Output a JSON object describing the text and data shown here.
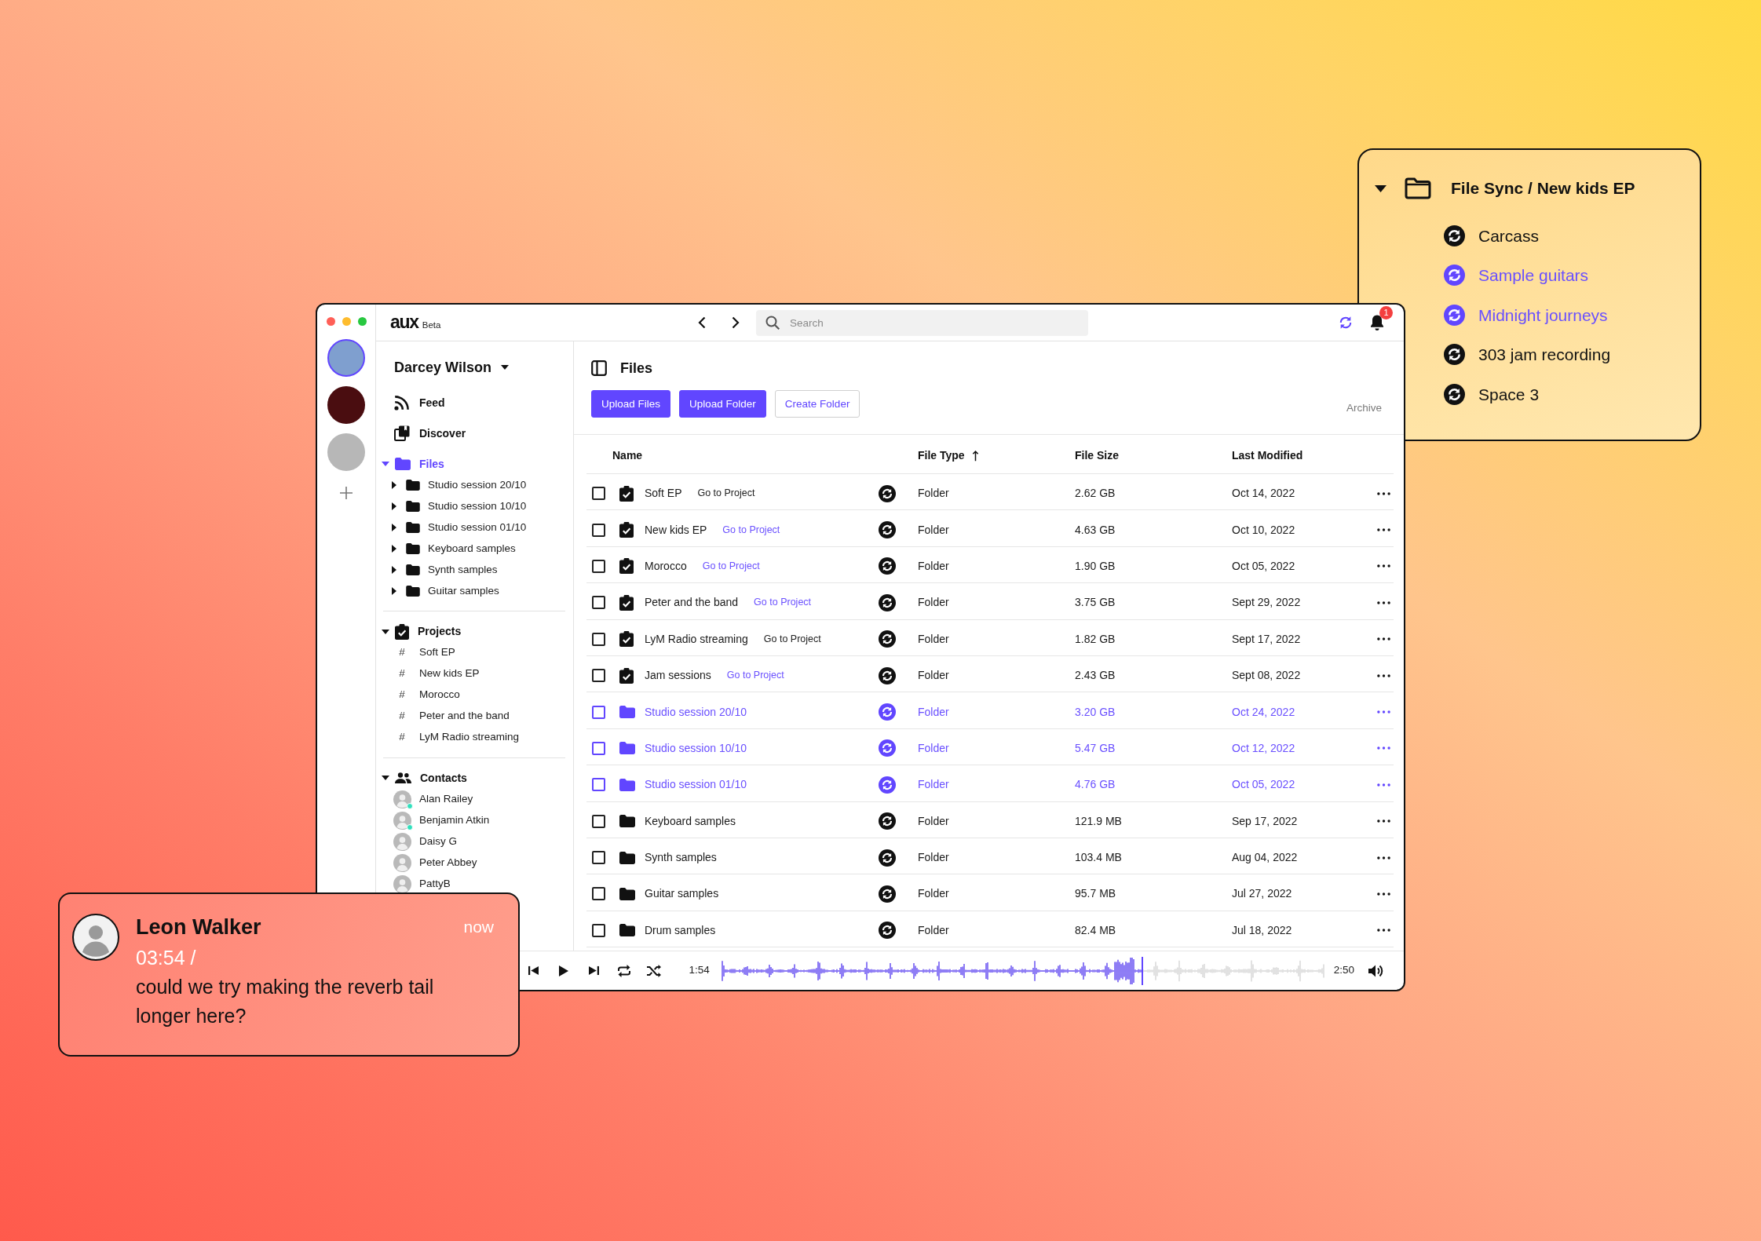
{
  "workspaces": [
    {
      "selected": true
    },
    {
      "selected": false
    },
    {
      "selected": false
    }
  ],
  "topbar": {
    "logo": "aux",
    "logo_tag": "Beta",
    "search": {
      "placeholder": "Search"
    },
    "notification_count": "1"
  },
  "sidebar": {
    "user": "Darcey Wilson",
    "nav": [
      {
        "kind": "feed",
        "label": "Feed",
        "selected": false
      },
      {
        "kind": "discover",
        "label": "Discover",
        "selected": false
      }
    ],
    "sections": [
      {
        "kind": "files",
        "label": "Files",
        "selected": true,
        "expanded": true,
        "items": [
          {
            "label": "Studio session 20/10",
            "expanded": false
          },
          {
            "label": "Studio session 10/10",
            "expanded": false
          },
          {
            "label": "Studio session 01/10",
            "expanded": false
          },
          {
            "label": "Keyboard samples",
            "expanded": false
          },
          {
            "label": "Synth samples",
            "expanded": false
          },
          {
            "label": "Guitar samples",
            "expanded": false
          }
        ]
      },
      {
        "kind": "projects",
        "label": "Projects",
        "selected": false,
        "expanded": true,
        "items": [
          {
            "marker": "#",
            "label": "Soft EP"
          },
          {
            "marker": "#",
            "label": "New kids EP"
          },
          {
            "marker": "#",
            "label": "Morocco"
          },
          {
            "marker": "#",
            "label": "Peter and the band"
          },
          {
            "marker": "#",
            "label": "LyM Radio streaming"
          }
        ]
      },
      {
        "kind": "contacts",
        "label": "Contacts",
        "selected": false,
        "expanded": true,
        "items": [
          {
            "name": "Alan Railey",
            "online": true
          },
          {
            "name": "Benjamin Atkin",
            "online": true
          },
          {
            "name": "Daisy G",
            "online": false
          },
          {
            "name": "Peter Abbey",
            "online": false
          },
          {
            "name": "PattyB",
            "online": false
          }
        ]
      }
    ]
  },
  "main": {
    "title": "Files",
    "buttons": [
      {
        "label": "Upload Files",
        "kind": "primary"
      },
      {
        "label": "Upload Folder",
        "kind": "primary"
      },
      {
        "label": "Create Folder",
        "kind": "outline"
      }
    ],
    "archive": "Archive",
    "table": {
      "columns": [
        {
          "label": "Name",
          "sorted": false
        },
        {
          "label": "File Type",
          "sorted": true
        },
        {
          "label": "File Size",
          "sorted": false
        },
        {
          "label": "Last Modified",
          "sorted": false
        }
      ],
      "rows": [
        {
          "kind": "project",
          "name": "Soft EP",
          "link": "Go to Project",
          "link_highlighted": false,
          "highlighted": false,
          "checked": false,
          "type": "Folder",
          "size": "2.62 GB",
          "modified": "Oct 14, 2022"
        },
        {
          "kind": "project",
          "name": "New kids EP",
          "link": "Go to Project",
          "link_highlighted": true,
          "highlighted": false,
          "checked": false,
          "type": "Folder",
          "size": "4.63 GB",
          "modified": "Oct 10, 2022"
        },
        {
          "kind": "project",
          "name": "Morocco",
          "link": "Go to Project",
          "link_highlighted": true,
          "highlighted": false,
          "checked": false,
          "type": "Folder",
          "size": "1.90 GB",
          "modified": "Oct 05, 2022"
        },
        {
          "kind": "project",
          "name": "Peter and the band",
          "link": "Go to Project",
          "link_highlighted": true,
          "highlighted": false,
          "checked": false,
          "type": "Folder",
          "size": "3.75 GB",
          "modified": "Sept 29, 2022"
        },
        {
          "kind": "project",
          "name": "LyM Radio streaming",
          "link": "Go to Project",
          "link_highlighted": false,
          "highlighted": false,
          "checked": false,
          "type": "Folder",
          "size": "1.82 GB",
          "modified": "Sept 17, 2022"
        },
        {
          "kind": "project",
          "name": "Jam sessions",
          "link": "Go to Project",
          "link_highlighted": true,
          "highlighted": false,
          "checked": false,
          "type": "Folder",
          "size": "2.43 GB",
          "modified": "Sept 08, 2022"
        },
        {
          "kind": "folder",
          "name": "Studio session 20/10",
          "highlighted": true,
          "checked": false,
          "type": "Folder",
          "size": "3.20 GB",
          "modified": "Oct 24, 2022"
        },
        {
          "kind": "folder",
          "name": "Studio session 10/10",
          "highlighted": true,
          "checked": false,
          "type": "Folder",
          "size": "5.47 GB",
          "modified": "Oct 12, 2022"
        },
        {
          "kind": "folder",
          "name": "Studio session 01/10",
          "highlighted": true,
          "checked": false,
          "type": "Folder",
          "size": "4.76 GB",
          "modified": "Oct 05, 2022"
        },
        {
          "kind": "folder",
          "name": "Keyboard samples",
          "highlighted": false,
          "checked": false,
          "type": "Folder",
          "size": "121.9 MB",
          "modified": "Sep 17, 2022"
        },
        {
          "kind": "folder",
          "name": "Synth samples",
          "highlighted": false,
          "checked": false,
          "type": "Folder",
          "size": "103.4 MB",
          "modified": "Aug 04, 2022"
        },
        {
          "kind": "folder",
          "name": "Guitar samples",
          "highlighted": false,
          "checked": false,
          "type": "Folder",
          "size": "95.7 MB",
          "modified": "Jul 27, 2022"
        },
        {
          "kind": "folder",
          "name": "Drum samples",
          "highlighted": false,
          "checked": false,
          "type": "Folder",
          "size": "82.4 MB",
          "modified": "Jul 18, 2022"
        }
      ]
    }
  },
  "player": {
    "elapsed": "1:54",
    "duration": "2:50",
    "level": 0.7
  },
  "sync_card": {
    "title": "File Sync / New kids EP",
    "expanded": true,
    "items": [
      {
        "label": "Carcass",
        "active": false
      },
      {
        "label": "Sample guitars",
        "active": true
      },
      {
        "label": "Midnight journeys",
        "active": true
      },
      {
        "label": "303 jam recording",
        "active": false
      },
      {
        "label": "Space 3",
        "active": false
      }
    ]
  },
  "notification": {
    "sender": "Leon Walker",
    "time": "now",
    "timestamp": "03:54 /",
    "message": "could we try making the reverb tail longer here?"
  }
}
